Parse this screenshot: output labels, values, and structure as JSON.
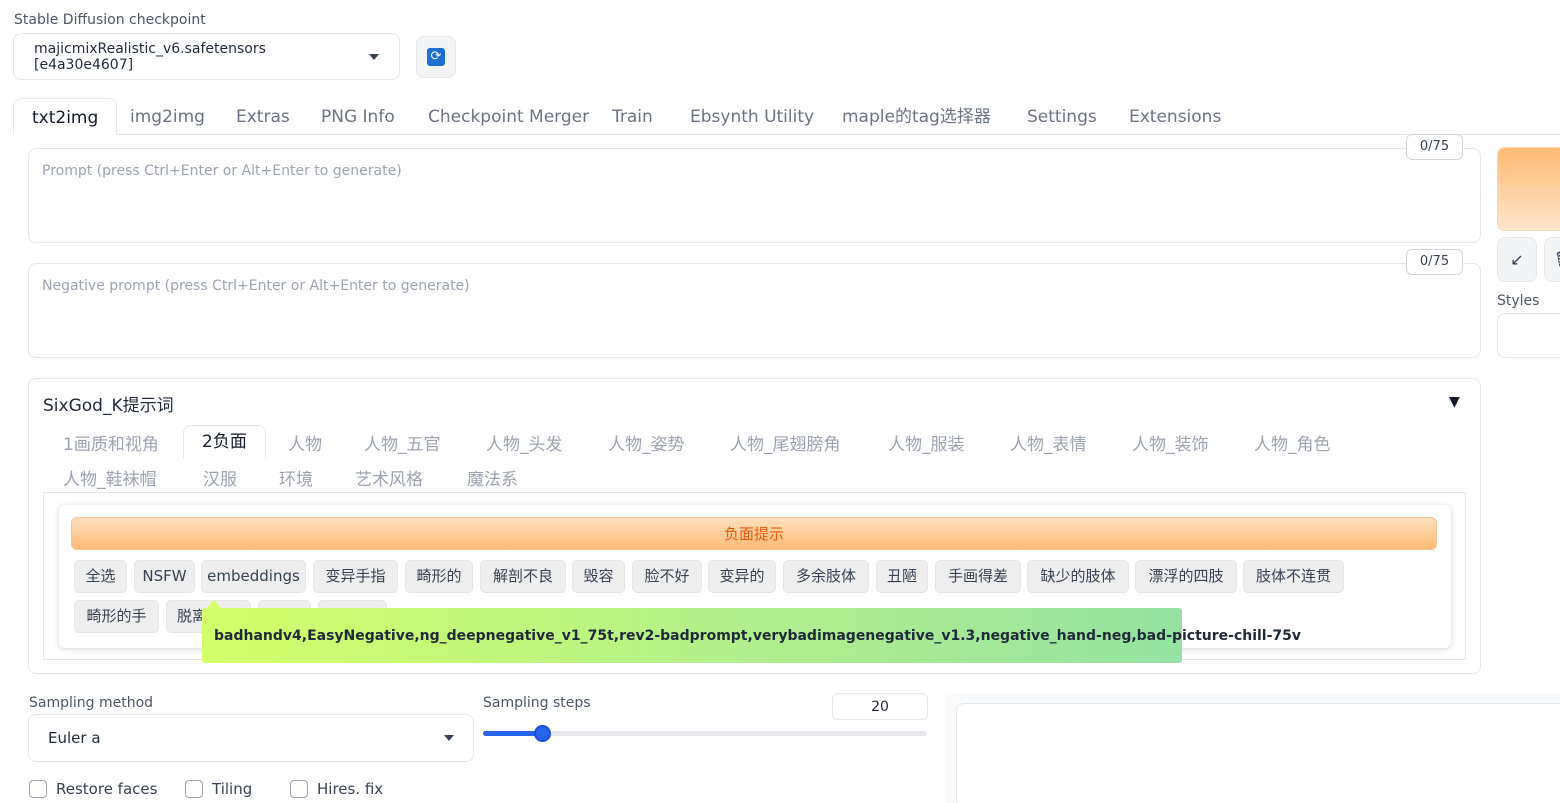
{
  "checkpoint": {
    "label": "Stable Diffusion checkpoint",
    "value": "majicmixRealistic_v6.safetensors [e4a30e4607]",
    "refresh_icon": "refresh-icon"
  },
  "tabs": [
    "txt2img",
    "img2img",
    "Extras",
    "PNG Info",
    "Checkpoint Merger",
    "Train",
    "Ebsynth Utility",
    "maple的tag选择器",
    "Settings",
    "Extensions"
  ],
  "prompt": {
    "placeholder": "Prompt (press Ctrl+Enter or Alt+Enter to generate)",
    "counter": "0/75"
  },
  "negative_prompt": {
    "placeholder": "Negative prompt (press Ctrl+Enter or Alt+Enter to generate)",
    "counter": "0/75"
  },
  "side": {
    "arrow_icon": "↙",
    "trash_icon": "🗑",
    "styles_label": "Styles"
  },
  "sixgod": {
    "title": "SixGod_K提示词",
    "toggle": "▼",
    "sub_tabs": [
      "1画质和视角",
      "2负面",
      "人物",
      "人物_五官",
      "人物_头发",
      "人物_姿势",
      "人物_尾翅膀角",
      "人物_服装",
      "人物_表情",
      "人物_装饰",
      "人物_角色",
      "人物_鞋袜帽",
      "汉服",
      "环境",
      "艺术风格",
      "魔法系"
    ],
    "section_header": "负面提示",
    "chips": [
      "全选",
      "NSFW",
      "embeddings",
      "变异手指",
      "畸形的",
      "解剖不良",
      "毁容",
      "脸不好",
      "变异的",
      "多余肢体",
      "丑陋",
      "手画得差",
      "缺少的肢体",
      "漂浮的四肢",
      "肢体不连贯",
      "畸形的手",
      "脱离"
    ],
    "tooltip": "badhandv4,EasyNegative,ng_deepnegative_v1_75t,rev2-badprompt,verybadimagenegative_v1.3,negative_hand-neg,bad-picture-chill-75v"
  },
  "sampling": {
    "method_label": "Sampling method",
    "method_value": "Euler a",
    "steps_label": "Sampling steps",
    "steps_value": "20",
    "steps_fraction": 0.135
  },
  "checkboxes": [
    "Restore faces",
    "Tiling",
    "Hires. fix"
  ]
}
